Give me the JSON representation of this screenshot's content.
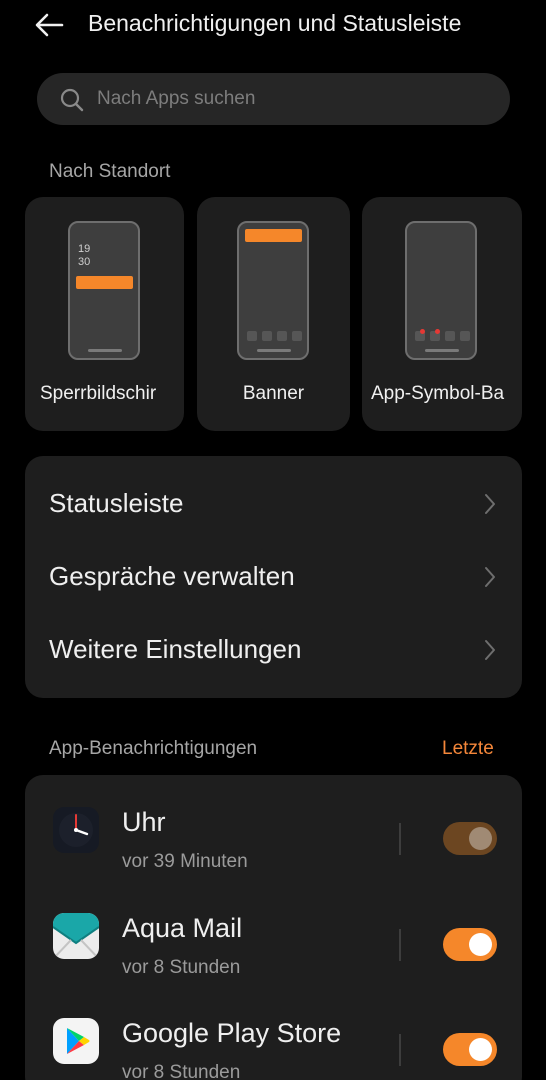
{
  "header": {
    "title": "Benachrichtigungen und Statusleiste",
    "back_icon": "arrow-left-icon"
  },
  "search": {
    "placeholder": "Nach Apps suchen",
    "icon": "search-icon"
  },
  "location_section": {
    "title": "Nach Standort",
    "cards": [
      {
        "label": "Sperrbildschir",
        "preview_clock": [
          "19",
          "30"
        ]
      },
      {
        "label": "Banner"
      },
      {
        "label": "App-Symbol-Ba"
      }
    ]
  },
  "menu": {
    "items": [
      {
        "label": "Statusleiste"
      },
      {
        "label": "Gespräche verwalten"
      },
      {
        "label": "Weitere Einstellungen"
      }
    ]
  },
  "apps_section": {
    "title": "App-Benachrichtigungen",
    "sort_label": "Letzte",
    "apps": [
      {
        "name": "Uhr",
        "time": "vor 39 Minuten",
        "enabled": true,
        "toggle_state": "dimmed",
        "icon": "clock-app-icon"
      },
      {
        "name": "Aqua Mail",
        "time": "vor 8 Stunden",
        "enabled": true,
        "icon": "mail-envelope-icon"
      },
      {
        "name": "Google Play Store",
        "time": "vor 8 Stunden",
        "enabled": true,
        "icon": "play-store-icon"
      }
    ]
  },
  "colors": {
    "accent": "#f5872a",
    "background": "#000000",
    "card": "#1e1e1e",
    "toggle_dimmed": "#6c4621"
  }
}
